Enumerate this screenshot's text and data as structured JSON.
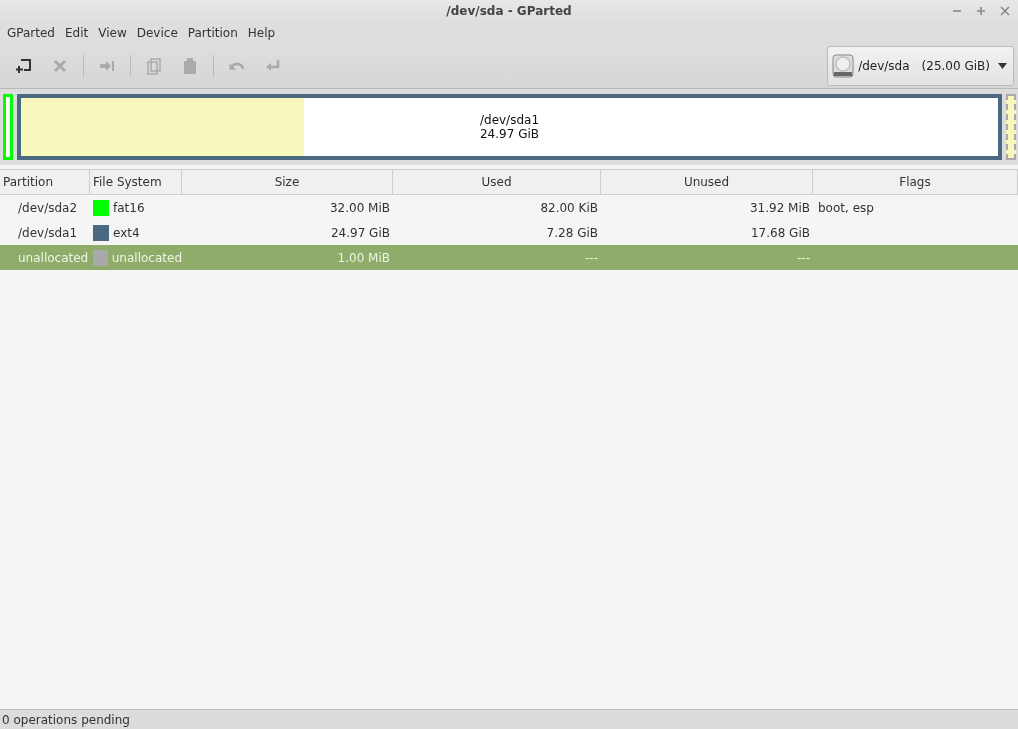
{
  "window": {
    "title": "/dev/sda - GParted"
  },
  "menu": [
    "GParted",
    "Edit",
    "View",
    "Device",
    "Partition",
    "Help"
  ],
  "toolbar": [
    {
      "kind": "new",
      "disabled": false
    },
    {
      "kind": "delete",
      "disabled": true
    },
    {
      "kind": "sep"
    },
    {
      "kind": "resize",
      "disabled": true
    },
    {
      "kind": "sep"
    },
    {
      "kind": "copy",
      "disabled": true
    },
    {
      "kind": "paste",
      "disabled": true
    },
    {
      "kind": "sep"
    },
    {
      "kind": "undo",
      "disabled": true
    },
    {
      "kind": "apply",
      "disabled": true
    }
  ],
  "device": {
    "name": "/dev/sda",
    "size": "(25.00 GiB)"
  },
  "disk_map": [
    {
      "kind": "small",
      "color": "#00ff00"
    },
    {
      "kind": "main",
      "color": "#4b6983",
      "level": 0.29,
      "name": "/dev/sda1",
      "size": "24.97 GiB"
    },
    {
      "kind": "unallocated",
      "color": "#a9a9a9"
    }
  ],
  "table": {
    "columns": [
      "Partition",
      "File System",
      "Size",
      "Used",
      "Unused",
      "Flags"
    ],
    "rows": [
      {
        "partition": "/dev/sda2",
        "color": "#00ff00",
        "fs": "fat16",
        "size": "32.00 MiB",
        "used": "82.00 KiB",
        "unused": "31.92 MiB",
        "flags": "boot, esp",
        "selected": false
      },
      {
        "partition": "/dev/sda1",
        "color": "#4b6983",
        "fs": "ext4",
        "size": "24.97 GiB",
        "used": "7.28 GiB",
        "unused": "17.68 GiB",
        "flags": "",
        "selected": false
      },
      {
        "partition": "unallocated",
        "color": "#a9a9a9",
        "fs": "unallocated",
        "size": "1.00 MiB",
        "used": "---",
        "unused": "---",
        "flags": "",
        "selected": true
      }
    ]
  },
  "status_bar": "0 operations pending"
}
